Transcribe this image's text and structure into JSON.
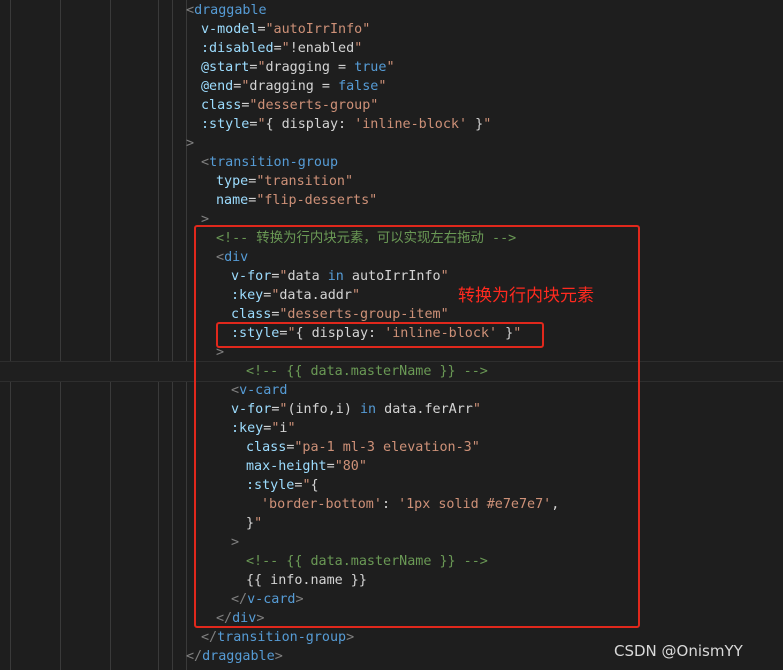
{
  "code_lines": [
    {
      "indent": 186,
      "segments": [
        {
          "c": "br",
          "t": "<"
        },
        {
          "c": "tag",
          "t": "draggable"
        }
      ]
    },
    {
      "indent": 201,
      "segments": [
        {
          "c": "attr",
          "t": "v-model"
        },
        {
          "c": "txt",
          "t": "="
        },
        {
          "c": "str",
          "t": "\"autoIrrInfo\""
        }
      ]
    },
    {
      "indent": 201,
      "segments": [
        {
          "c": "attr",
          "t": ":disabled"
        },
        {
          "c": "txt",
          "t": "="
        },
        {
          "c": "str",
          "t": "\""
        },
        {
          "c": "txt",
          "t": "!enabled"
        },
        {
          "c": "str",
          "t": "\""
        }
      ]
    },
    {
      "indent": 201,
      "segments": [
        {
          "c": "attr",
          "t": "@start"
        },
        {
          "c": "txt",
          "t": "="
        },
        {
          "c": "str",
          "t": "\""
        },
        {
          "c": "txt",
          "t": "dragging = "
        },
        {
          "c": "kw",
          "t": "true"
        },
        {
          "c": "str",
          "t": "\""
        }
      ]
    },
    {
      "indent": 201,
      "segments": [
        {
          "c": "attr",
          "t": "@end"
        },
        {
          "c": "txt",
          "t": "="
        },
        {
          "c": "str",
          "t": "\""
        },
        {
          "c": "txt",
          "t": "dragging = "
        },
        {
          "c": "kw",
          "t": "false"
        },
        {
          "c": "str",
          "t": "\""
        }
      ]
    },
    {
      "indent": 201,
      "segments": [
        {
          "c": "attr",
          "t": "class"
        },
        {
          "c": "txt",
          "t": "="
        },
        {
          "c": "str",
          "t": "\"desserts-group\""
        }
      ]
    },
    {
      "indent": 201,
      "segments": [
        {
          "c": "attr",
          "t": ":style"
        },
        {
          "c": "txt",
          "t": "="
        },
        {
          "c": "str",
          "t": "\""
        },
        {
          "c": "txt",
          "t": "{ display: "
        },
        {
          "c": "str",
          "t": "'inline-block'"
        },
        {
          "c": "txt",
          "t": " }"
        },
        {
          "c": "str",
          "t": "\""
        }
      ]
    },
    {
      "indent": 186,
      "segments": [
        {
          "c": "br",
          "t": ">"
        }
      ]
    },
    {
      "indent": 201,
      "segments": [
        {
          "c": "br",
          "t": "<"
        },
        {
          "c": "tag",
          "t": "transition-group"
        }
      ]
    },
    {
      "indent": 216,
      "segments": [
        {
          "c": "attr",
          "t": "type"
        },
        {
          "c": "txt",
          "t": "="
        },
        {
          "c": "str",
          "t": "\"transition\""
        }
      ]
    },
    {
      "indent": 216,
      "segments": [
        {
          "c": "attr",
          "t": "name"
        },
        {
          "c": "txt",
          "t": "="
        },
        {
          "c": "str",
          "t": "\"flip-desserts\""
        }
      ]
    },
    {
      "indent": 201,
      "segments": [
        {
          "c": "br",
          "t": ">"
        }
      ]
    },
    {
      "indent": 216,
      "segments": [
        {
          "c": "com",
          "t": "<!-- 转换为行内块元素，可以实现左右拖动 -->"
        }
      ]
    },
    {
      "indent": 216,
      "segments": [
        {
          "c": "br",
          "t": "<"
        },
        {
          "c": "tag",
          "t": "div"
        }
      ]
    },
    {
      "indent": 231,
      "segments": [
        {
          "c": "attr",
          "t": "v-for"
        },
        {
          "c": "txt",
          "t": "="
        },
        {
          "c": "str",
          "t": "\""
        },
        {
          "c": "txt",
          "t": "data "
        },
        {
          "c": "kw",
          "t": "in"
        },
        {
          "c": "txt",
          "t": " autoIrrInfo"
        },
        {
          "c": "str",
          "t": "\""
        }
      ]
    },
    {
      "indent": 231,
      "segments": [
        {
          "c": "attr",
          "t": ":key"
        },
        {
          "c": "txt",
          "t": "="
        },
        {
          "c": "str",
          "t": "\""
        },
        {
          "c": "txt",
          "t": "data.addr"
        },
        {
          "c": "str",
          "t": "\""
        }
      ]
    },
    {
      "indent": 231,
      "segments": [
        {
          "c": "attr",
          "t": "class"
        },
        {
          "c": "txt",
          "t": "="
        },
        {
          "c": "str",
          "t": "\"desserts-group-item\""
        }
      ]
    },
    {
      "indent": 231,
      "segments": [
        {
          "c": "attr",
          "t": ":style"
        },
        {
          "c": "txt",
          "t": "="
        },
        {
          "c": "str",
          "t": "\""
        },
        {
          "c": "txt",
          "t": "{ display: "
        },
        {
          "c": "str",
          "t": "'inline-block'"
        },
        {
          "c": "txt",
          "t": " }"
        },
        {
          "c": "str",
          "t": "\""
        }
      ]
    },
    {
      "indent": 216,
      "segments": [
        {
          "c": "br",
          "t": ">"
        }
      ]
    },
    {
      "indent": 246,
      "segments": [
        {
          "c": "com",
          "t": "<!-- {{ data.masterName }} -->"
        }
      ]
    },
    {
      "indent": 231,
      "segments": [
        {
          "c": "br",
          "t": "<"
        },
        {
          "c": "tag",
          "t": "v-card"
        }
      ]
    },
    {
      "indent": 231,
      "segments": [
        {
          "c": "attr",
          "t": "v-for"
        },
        {
          "c": "txt",
          "t": "="
        },
        {
          "c": "str",
          "t": "\""
        },
        {
          "c": "txt",
          "t": "(info,i) "
        },
        {
          "c": "kw",
          "t": "in"
        },
        {
          "c": "txt",
          "t": " data.ferArr"
        },
        {
          "c": "str",
          "t": "\""
        }
      ]
    },
    {
      "indent": 231,
      "segments": [
        {
          "c": "attr",
          "t": ":key"
        },
        {
          "c": "txt",
          "t": "="
        },
        {
          "c": "str",
          "t": "\""
        },
        {
          "c": "txt",
          "t": "i"
        },
        {
          "c": "str",
          "t": "\""
        }
      ]
    },
    {
      "indent": 246,
      "segments": [
        {
          "c": "attr",
          "t": "class"
        },
        {
          "c": "txt",
          "t": "="
        },
        {
          "c": "str",
          "t": "\"pa-1 ml-3 elevation-3\""
        }
      ]
    },
    {
      "indent": 246,
      "segments": [
        {
          "c": "attr",
          "t": "max-height"
        },
        {
          "c": "txt",
          "t": "="
        },
        {
          "c": "str",
          "t": "\"80\""
        }
      ]
    },
    {
      "indent": 246,
      "segments": [
        {
          "c": "attr",
          "t": ":style"
        },
        {
          "c": "txt",
          "t": "="
        },
        {
          "c": "str",
          "t": "\""
        },
        {
          "c": "txt",
          "t": "{"
        }
      ]
    },
    {
      "indent": 261,
      "segments": [
        {
          "c": "str",
          "t": "'border-bottom'"
        },
        {
          "c": "txt",
          "t": ": "
        },
        {
          "c": "str",
          "t": "'1px solid #e7e7e7'"
        },
        {
          "c": "txt",
          "t": ","
        }
      ]
    },
    {
      "indent": 246,
      "segments": [
        {
          "c": "txt",
          "t": "}"
        },
        {
          "c": "str",
          "t": "\""
        }
      ]
    },
    {
      "indent": 231,
      "segments": [
        {
          "c": "br",
          "t": ">"
        }
      ]
    },
    {
      "indent": 246,
      "segments": [
        {
          "c": "com",
          "t": "<!-- {{ data.masterName }} -->"
        }
      ]
    },
    {
      "indent": 246,
      "segments": [
        {
          "c": "txt",
          "t": "{{ info.name }}"
        }
      ]
    },
    {
      "indent": 231,
      "segments": [
        {
          "c": "br",
          "t": "</"
        },
        {
          "c": "tag",
          "t": "v-card"
        },
        {
          "c": "br",
          "t": ">"
        }
      ]
    },
    {
      "indent": 216,
      "segments": [
        {
          "c": "br",
          "t": "</"
        },
        {
          "c": "tag",
          "t": "div"
        },
        {
          "c": "br",
          "t": ">"
        }
      ]
    },
    {
      "indent": 201,
      "segments": [
        {
          "c": "br",
          "t": "</"
        },
        {
          "c": "tag",
          "t": "transition-group"
        },
        {
          "c": "br",
          "t": ">"
        }
      ]
    },
    {
      "indent": 186,
      "segments": [
        {
          "c": "br",
          "t": "</"
        },
        {
          "c": "tag",
          "t": "draggable"
        },
        {
          "c": "br",
          "t": ">"
        }
      ]
    }
  ],
  "annotation": {
    "text": "转换为行内块元素"
  },
  "watermark": {
    "text": "CSDN @OnismYY"
  },
  "colors": {
    "background": "#1e1e1e",
    "tag": "#569cd6",
    "attribute": "#9cdcfe",
    "string": "#ce9178",
    "comment": "#6a9955",
    "highlight_box": "#e0281c"
  }
}
